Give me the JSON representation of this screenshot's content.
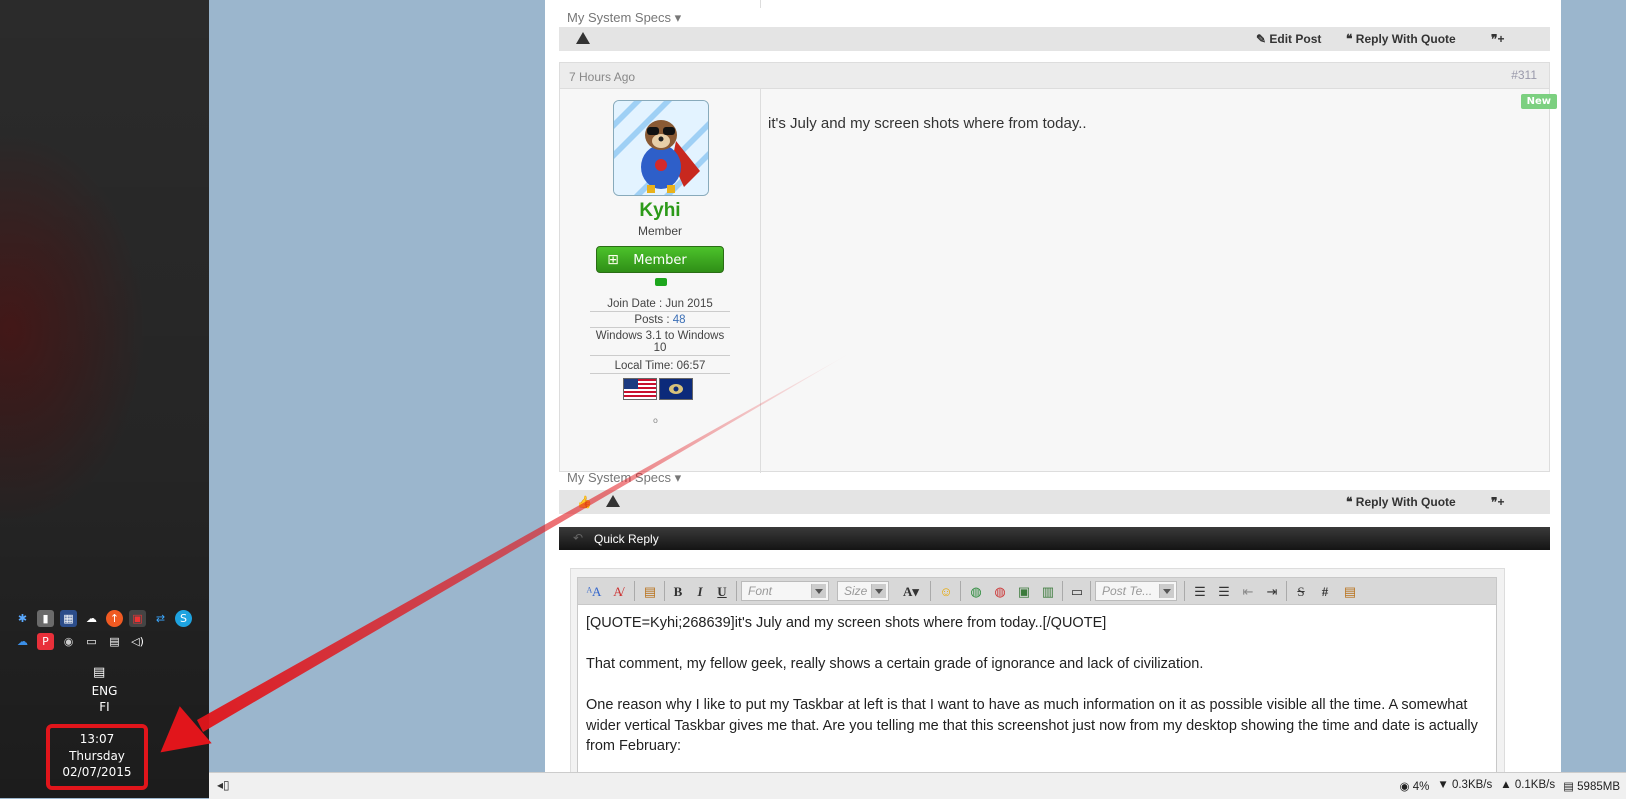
{
  "tray": {
    "lang_1": "ENG",
    "lang_2": "FI",
    "time": "13:07",
    "day": "Thursday",
    "date": "02/07/2015"
  },
  "prev_post": {
    "specs_label": "My System Specs",
    "edit_label": "Edit Post",
    "reply_quote_label": "Reply With Quote"
  },
  "post": {
    "date": "7 Hours Ago",
    "number": "#311",
    "new_badge": "New",
    "username": "Kyhi",
    "user_title": "Member",
    "rank_label": "Member",
    "join_date": "Join Date : Jun 2015",
    "posts_label": "Posts : ",
    "posts_count": "48",
    "os": "Windows 3.1 to Windows 10",
    "local_time": "Local Time: 06:57",
    "online_indicator": "o",
    "body": "it's July and my screen shots where from today..",
    "specs_label": "My System Specs",
    "reply_quote_label": "Reply With Quote"
  },
  "quick_reply": {
    "title": "Quick Reply",
    "toolbar": {
      "bold": "B",
      "italic": "I",
      "underline": "U",
      "font_placeholder": "Font",
      "size_placeholder": "Size",
      "text_color": "A",
      "post_template_placeholder": "Post Te...",
      "strike": "S",
      "hash": "#"
    },
    "content": {
      "line1": "[QUOTE=Kyhi;268639]it's July and my screen shots where from today..[/QUOTE]",
      "line2": "That comment, my fellow geek, really shows a certain grade of ignorance and lack of civilization.",
      "line3": "One reason why I like to put my Taskbar at left is that I want to have as much information on it as possible visible all the time. A somewhat wider vertical Taskbar gives me that. Are you telling me that this screenshot just now from my desktop showing the time and date is actually from February:"
    }
  },
  "statusbar": {
    "cpu": "4%",
    "down": "0.3KB/s",
    "up": "0.1KB/s",
    "mem": "5985MB"
  },
  "colors": {
    "username_green": "#2c9a19",
    "highlight_red": "#e1151b",
    "desktop_blue": "#9bb6cd"
  }
}
